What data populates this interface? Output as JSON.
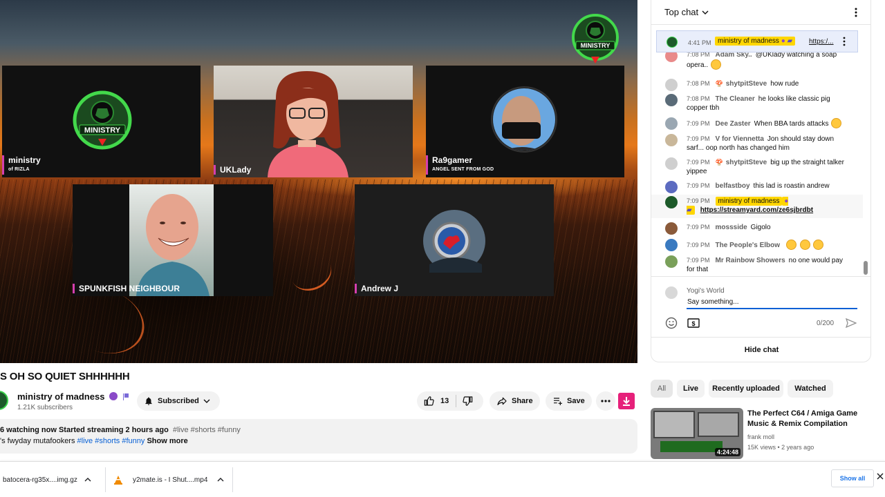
{
  "video": {
    "title": "S OH SO QUIET SHHHHHH",
    "overlay_logo_text": "MINISTRY",
    "participants": [
      {
        "name": "ministry",
        "subtitle": "of RIZLA"
      },
      {
        "name": "UKLady",
        "subtitle": ""
      },
      {
        "name": "Ra9gamer",
        "subtitle": "ANGEL SENT FROM GOD"
      },
      {
        "name": "SPUNKFISH NEIGHBOUR",
        "subtitle": ""
      },
      {
        "name": "Andrew J",
        "subtitle": ""
      }
    ]
  },
  "channel": {
    "name": "ministry of madness",
    "subscribers": "1.21K subscribers",
    "subscribe_label": "Subscribed"
  },
  "actions": {
    "likes": "13",
    "share_label": "Share",
    "save_label": "Save"
  },
  "description": {
    "stats": "6 watching now  Started streaming 2 hours ago",
    "stat_tags": "#live #shorts #funny",
    "text": "'s fwyday mutafookers",
    "text_tags": "#live #shorts #funny",
    "show_more": "Show more"
  },
  "chat": {
    "header": "Top chat",
    "pinned": {
      "time": "4:41 PM",
      "author": "ministry of madness",
      "link": "https:/..."
    },
    "messages": [
      {
        "time": "7:08 PM",
        "author": "Adam Sky..",
        "text": "@UKlady watching a soap opera..",
        "emoji": true,
        "color": "#e98a8a"
      },
      {
        "time": "7:08 PM",
        "author": "shytpitSteve",
        "text": "how rude",
        "star": true,
        "color": "#cfcfcf"
      },
      {
        "time": "7:08 PM",
        "author": "The Cleaner",
        "text": "he looks like classic pig copper tbh",
        "color": "#5a6b78"
      },
      {
        "time": "7:09 PM",
        "author": "Dee Zaster",
        "text": "When BBA tards attacks",
        "emoji": true,
        "color": "#9aa7b2"
      },
      {
        "time": "7:09 PM",
        "author": "V for Viennetta",
        "text": "Jon should stay down sarf... oop north has changed him",
        "color": "#c9b79a"
      },
      {
        "time": "7:09 PM",
        "author": "shytpitSteve",
        "text": "big up the straight talker yippee",
        "star": true,
        "color": "#cfcfcf"
      },
      {
        "time": "7:09 PM",
        "author": "belfastboy",
        "text": "this lad is roastin andrew",
        "color": "#5c6bc0"
      },
      {
        "time": "7:09 PM",
        "author": "ministry of madness",
        "text": "",
        "link": "https://streamyard.com/ze6sjbrdbt",
        "owner": true,
        "color": "#1d5a2a"
      },
      {
        "time": "7:09 PM",
        "author": "mossside",
        "text": "Gigolo",
        "color": "#8a5a3a"
      },
      {
        "time": "7:09 PM",
        "author": "The People's Elbow",
        "text": "",
        "emojis": 3,
        "color": "#3a7ac0"
      },
      {
        "time": "7:09 PM",
        "author": "Mr Rainbow Showers",
        "text": "no one would pay for that",
        "color": "#7aa05a"
      }
    ],
    "composer": {
      "user": "Yogi's World",
      "placeholder": "Say something...",
      "counter": "0/200"
    },
    "hide_label": "Hide chat"
  },
  "related": {
    "chips": [
      "All",
      "Live",
      "Recently uploaded",
      "Watched"
    ],
    "video": {
      "title": "The Perfect C64 / Amiga Game Music & Remix Compilation",
      "channel": "frank moll",
      "meta": "15K views  •  2 years ago",
      "duration": "4:24:48"
    }
  },
  "downloads": {
    "items": [
      "batocera-rg35x....img.gz",
      "y2mate.is - I Shut....mp4"
    ],
    "show_all": "Show all"
  },
  "colors": {
    "accent": "#065fd4",
    "tile_name_bar": "#d43fae",
    "owner_badge": "#ffd600",
    "download_button": "#e6207a"
  }
}
